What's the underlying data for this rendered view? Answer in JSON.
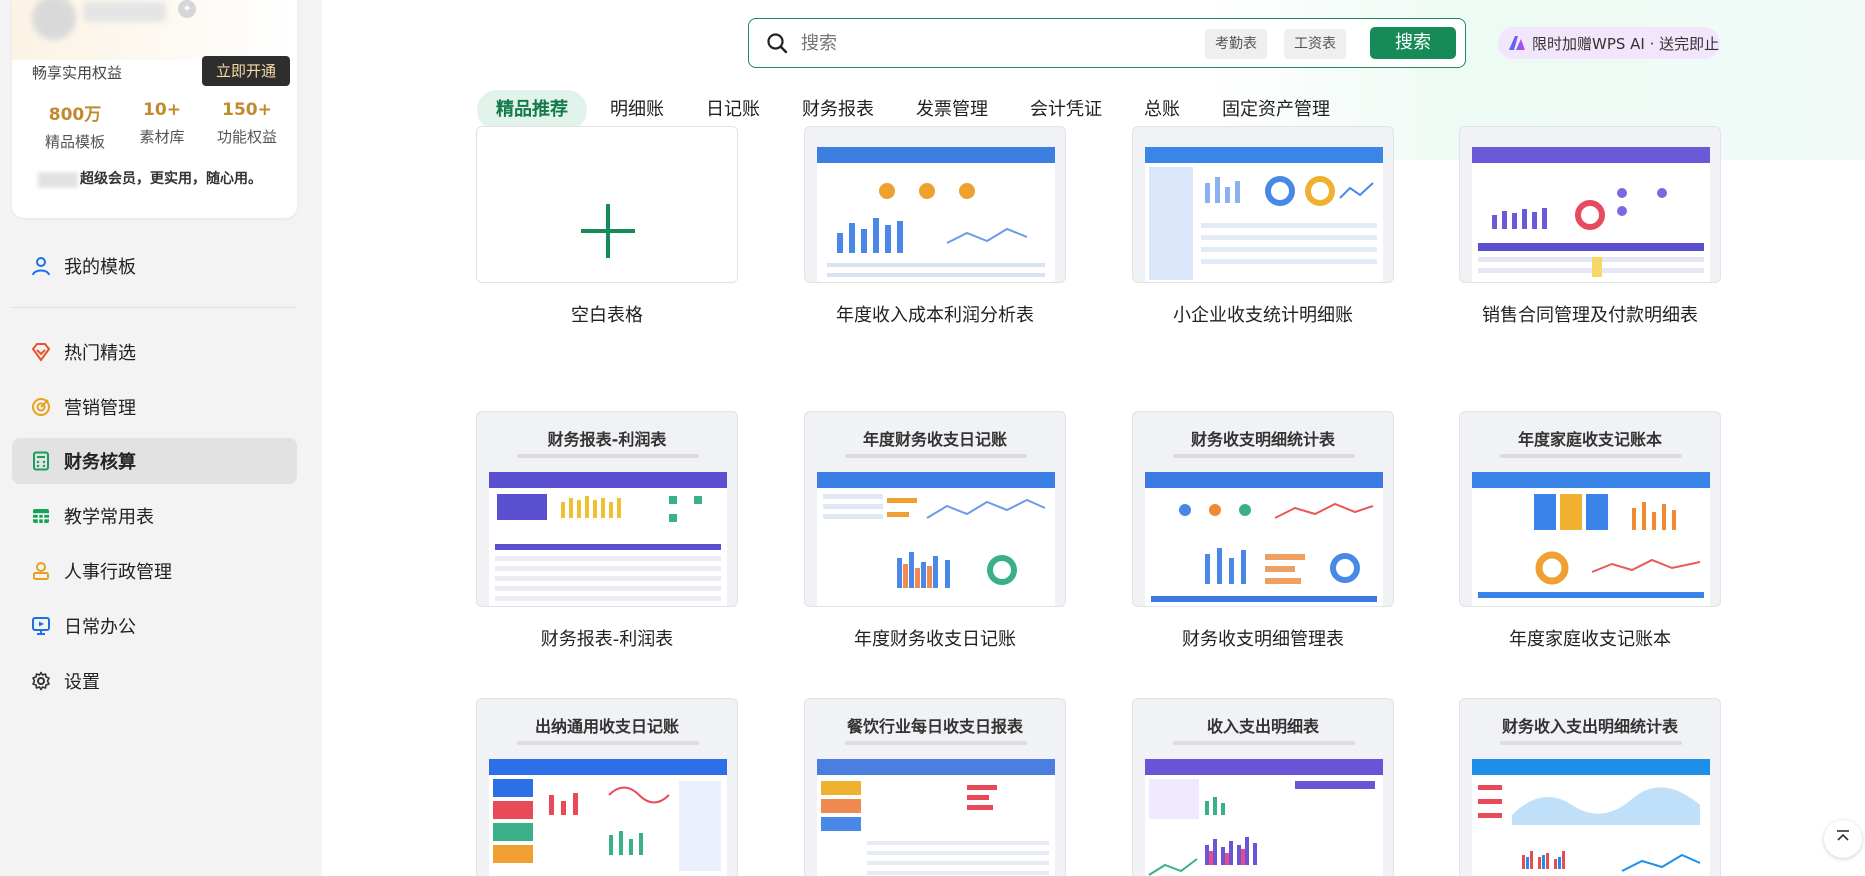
{
  "sidebar": {
    "member": {
      "benefit_text": "畅享实用权益",
      "open_button": "立即开通",
      "stats": [
        {
          "value": "800万",
          "label": "精品模板"
        },
        {
          "value": "10+",
          "label": "素材库"
        },
        {
          "value": "150+",
          "label": "功能权益"
        }
      ],
      "slogan": "超级会员，更实用，随心用。"
    },
    "my_templates": "我的模板",
    "categories": [
      {
        "label": "热门精选",
        "icon": "heart-diamond-icon",
        "color": "#e8522f"
      },
      {
        "label": "营销管理",
        "icon": "target-icon",
        "color": "#e8a020"
      },
      {
        "label": "财务核算",
        "icon": "calculator-icon",
        "color": "#18a058",
        "active": true
      },
      {
        "label": "教学常用表",
        "icon": "table-grid-icon",
        "color": "#18a058"
      },
      {
        "label": "人事行政管理",
        "icon": "person-stamp-icon",
        "color": "#e8a020"
      },
      {
        "label": "日常办公",
        "icon": "presentation-icon",
        "color": "#1f6fe8"
      },
      {
        "label": "设置",
        "icon": "gear-icon",
        "color": "#333333"
      }
    ]
  },
  "search": {
    "placeholder": "搜索",
    "chips": [
      "考勤表",
      "工资表"
    ],
    "button": "搜索"
  },
  "promo": {
    "text": "限时加赠WPS AI · 送完即止"
  },
  "tabs": [
    "精品推荐",
    "明细账",
    "日记账",
    "财务报表",
    "发票管理",
    "会计凭证",
    "总账",
    "固定资产管理"
  ],
  "templates": [
    {
      "label": "空白表格",
      "thumb_title": "",
      "blank": true
    },
    {
      "label": "年度收入成本利润分析表",
      "thumb_title": "",
      "accent": "#3d7fe0"
    },
    {
      "label": "小企业收支统计明细账",
      "thumb_title": "",
      "accent": "#3a85e8"
    },
    {
      "label": "销售合同管理及付款明细表",
      "thumb_title": "",
      "accent": "#6a5ad8"
    },
    {
      "label": "财务报表-利润表",
      "thumb_title": "财务报表-利润表",
      "accent": "#5a4fcf"
    },
    {
      "label": "年度财务收支日记账",
      "thumb_title": "年度财务收支日记账",
      "accent": "#3b7fe6"
    },
    {
      "label": "财务收支明细管理表",
      "thumb_title": "财务收支明细统计表",
      "accent": "#3c7ae3"
    },
    {
      "label": "年度家庭收支记账本",
      "thumb_title": "年度家庭收支记账本",
      "accent": "#3a83e8"
    },
    {
      "label": "",
      "thumb_title": "出纳通用收支日记账",
      "accent": "#2d6fe6"
    },
    {
      "label": "",
      "thumb_title": "餐饮行业每日收支日报表",
      "accent": "#4a7fe0"
    },
    {
      "label": "",
      "thumb_title": "收入支出明细表",
      "accent": "#6a55d6"
    },
    {
      "label": "",
      "thumb_title": "财务收入支出明细统计表",
      "accent": "#1e8fe8"
    }
  ]
}
